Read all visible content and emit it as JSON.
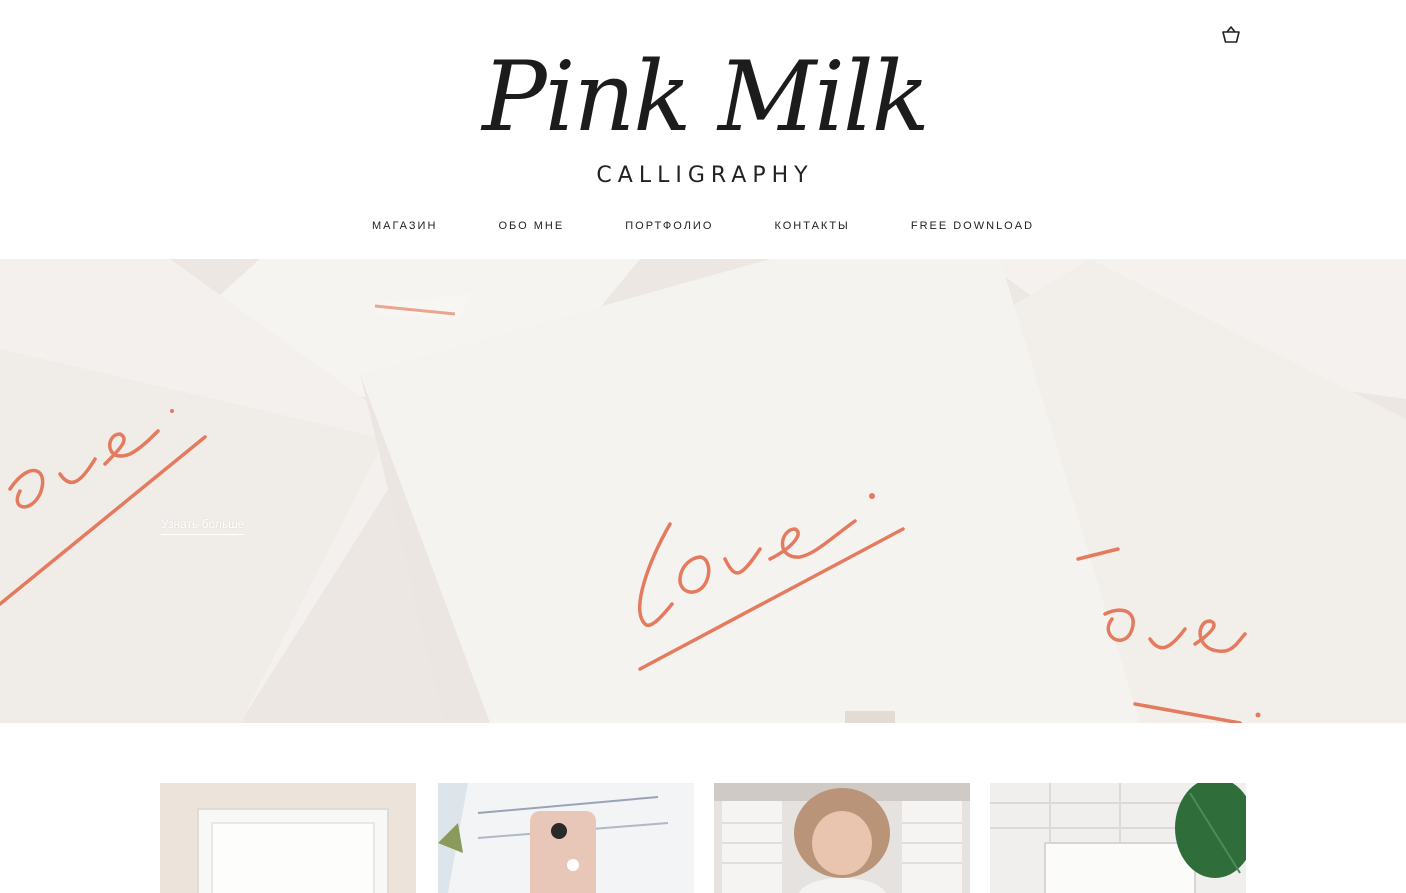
{
  "brand": {
    "logo_script": "Pink Milk",
    "logo_sub": "CALLIGRAPHY"
  },
  "nav": {
    "items": [
      {
        "label": "МАГАЗИН"
      },
      {
        "label": "ОБО МНЕ"
      },
      {
        "label": "ПОРТФОЛИО"
      },
      {
        "label": "КОНТАКТЫ"
      },
      {
        "label": "FREE DOWNLOAD"
      }
    ]
  },
  "hero": {
    "cta_label": "Узнать больше",
    "card_text": "Love.",
    "accent_color": "#e47a5e"
  },
  "gallery": {
    "tiles": [
      {
        "name": "frame-photo"
      },
      {
        "name": "phone-photo"
      },
      {
        "name": "portrait-photo"
      },
      {
        "name": "plant-photo"
      }
    ]
  },
  "icons": {
    "cart": "shopping-basket-icon"
  }
}
